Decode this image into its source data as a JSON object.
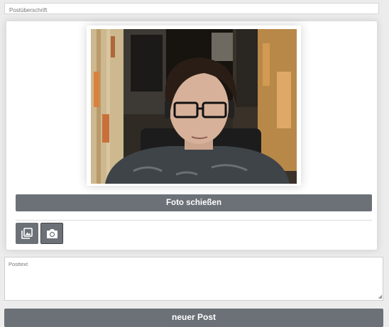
{
  "post": {
    "title_placeholder": "Postüberschrift",
    "text_placeholder": "Posttext",
    "submit_label": "neuer Post"
  },
  "media": {
    "take_photo_label": "Foto schießen",
    "icons": [
      "gallery-icon",
      "camera-icon"
    ]
  },
  "colors": {
    "button": "#6c7177",
    "background": "#ececec"
  }
}
